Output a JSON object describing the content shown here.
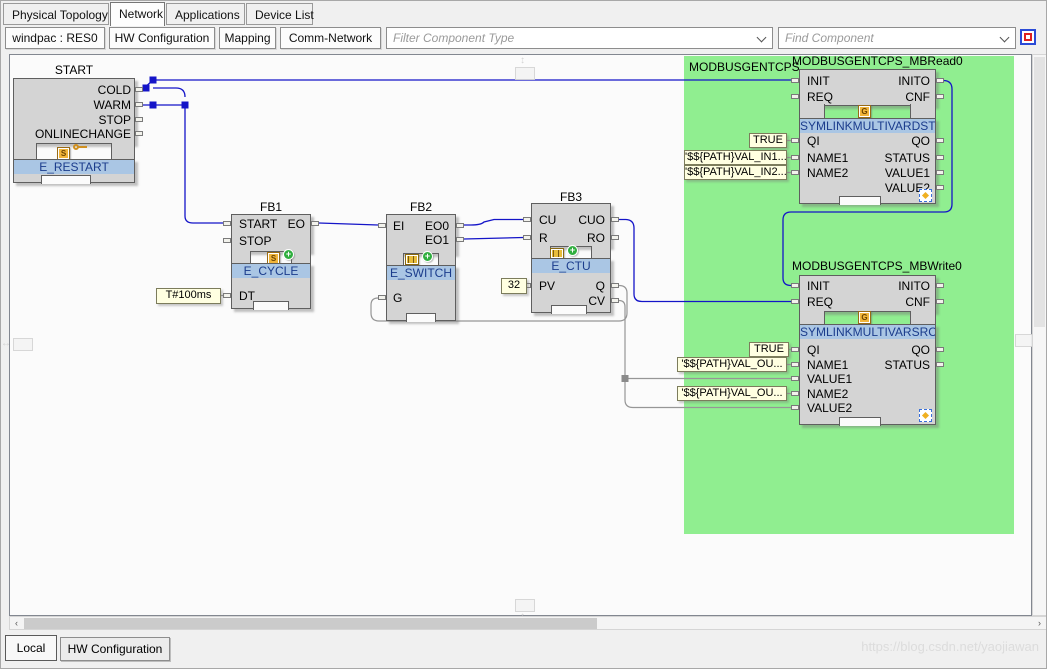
{
  "theme": {
    "chrome_bg": "#f0f0f0",
    "canvas_bg": "#fbfbfb",
    "group_green": "#90ee90",
    "block_fill": "#d4d4d4",
    "block_border": "#5f5f5f",
    "name_bar_bg": "#aac6e4",
    "name_bar_text": "#1b3c8c",
    "value_box_bg": "#ffffe1",
    "wire_event": "#1414c8",
    "wire_data": "#969696"
  },
  "top_tabs": {
    "items": [
      {
        "label": "Physical Topology",
        "active": false
      },
      {
        "label": "Network",
        "active": true
      },
      {
        "label": "Applications",
        "active": false
      },
      {
        "label": "Device List",
        "active": false
      }
    ]
  },
  "toolbar": {
    "resource_button": "windpac : RES0",
    "buttons": [
      "HW Configuration",
      "Mapping",
      "Comm-Network"
    ],
    "filter_combo_placeholder": "Filter Component Type",
    "find_combo_placeholder": "Find Component",
    "target_icon": "record-target-icon"
  },
  "canvas": {
    "group": {
      "label": "MODBUSGENTCPS"
    },
    "icons": {
      "s_letter": "S",
      "g_letter": "G",
      "add_glyph": "+"
    },
    "blocks": [
      {
        "title": "START",
        "type_name": "E_RESTART",
        "event_outputs": [
          "COLD",
          "WARM",
          "STOP",
          "ONLINECHANGE"
        ],
        "icons": [
          "subapp-s-icon",
          "key-icon"
        ]
      },
      {
        "title": "FB1",
        "type_name": "E_CYCLE",
        "event_inputs": [
          "START",
          "STOP"
        ],
        "event_outputs": [
          "EO"
        ],
        "data_inputs": [
          "DT"
        ],
        "input_values": [
          "T#100ms"
        ],
        "icons": [
          "subapp-s-icon",
          "add-icon"
        ]
      },
      {
        "title": "FB2",
        "type_name": "E_SWITCH",
        "event_inputs": [
          "EI"
        ],
        "event_outputs": [
          "EO0",
          "EO1"
        ],
        "data_inputs": [
          "G"
        ],
        "icons": [
          "chip-icon",
          "add-icon"
        ]
      },
      {
        "title": "FB3",
        "type_name": "E_CTU",
        "event_inputs": [
          "CU",
          "R"
        ],
        "event_outputs": [
          "CUO",
          "RO"
        ],
        "data_inputs": [
          "PV"
        ],
        "data_outputs": [
          "Q",
          "CV"
        ],
        "input_values": [
          "32"
        ],
        "icons": [
          "chip-icon",
          "add-icon"
        ]
      },
      {
        "title": "MODBUSGENTCPS_MBRead0",
        "type_name": "SYMLINKMULTIVARDST",
        "event_inputs": [
          "INIT",
          "REQ"
        ],
        "event_outputs": [
          "INITO",
          "CNF"
        ],
        "data_inputs": [
          "QI",
          "NAME1",
          "NAME2"
        ],
        "data_outputs": [
          "QO",
          "STATUS",
          "VALUE1",
          "VALUE2"
        ],
        "input_values": [
          "TRUE",
          "'$${PATH}VAL_IN1...",
          "'$${PATH}VAL_IN2..."
        ],
        "icons": [
          "global-g-icon",
          "shared-link-icon"
        ]
      },
      {
        "title": "MODBUSGENTCPS_MBWrite0",
        "type_name": "SYMLINKMULTIVARSRC",
        "event_inputs": [
          "INIT",
          "REQ"
        ],
        "event_outputs": [
          "INITO",
          "CNF"
        ],
        "data_inputs": [
          "QI",
          "NAME1",
          "VALUE1",
          "NAME2",
          "VALUE2"
        ],
        "data_outputs": [
          "QO",
          "STATUS"
        ],
        "input_values": [
          "TRUE",
          "'$${PATH}VAL_OU...",
          "'$${PATH}VAL_OU..."
        ],
        "icons": [
          "global-g-icon",
          "shared-link-icon"
        ]
      }
    ]
  },
  "scrollbar": {
    "left_arrow": "‹",
    "right_arrow": "›"
  },
  "bottom_tabs": {
    "items": [
      {
        "label": "Local",
        "active": true
      },
      {
        "label": "HW Configuration",
        "active": false
      }
    ]
  },
  "watermark": "https://blog.csdn.net/yaojiawan"
}
